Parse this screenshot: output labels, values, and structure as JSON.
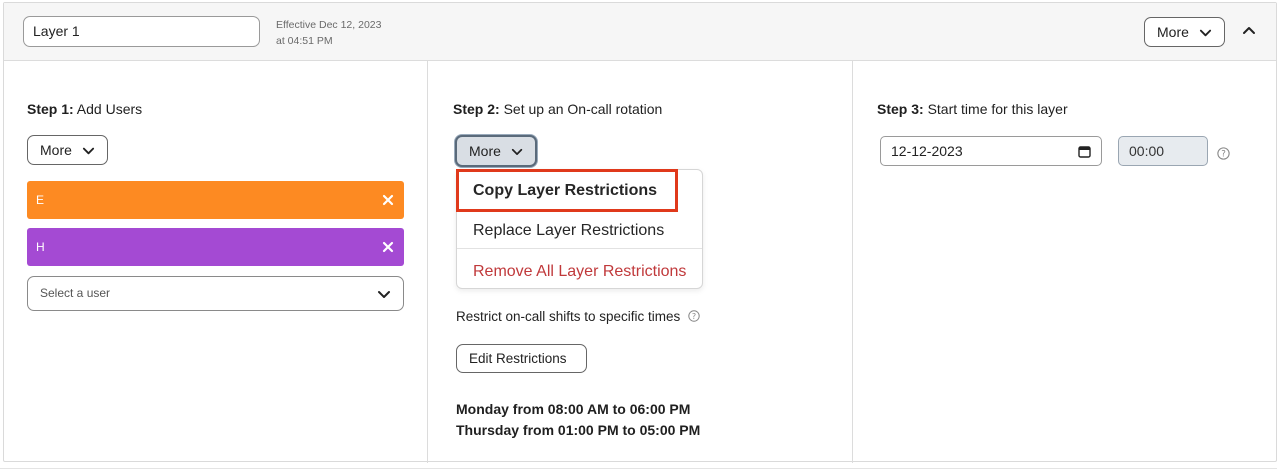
{
  "header": {
    "layer_name": "Layer 1",
    "effective": "Effective Dec 12, 2023 at 04:51 PM",
    "more_label": "More"
  },
  "step1": {
    "title_bold": "Step 1:",
    "title_text": " Add Users",
    "more_label": "More",
    "users": [
      {
        "initial": "E",
        "color": "#fd8a22"
      },
      {
        "initial": "H",
        "color": "#a44ad3"
      }
    ],
    "select_placeholder": "Select a user"
  },
  "step2": {
    "title_bold": "Step 2:",
    "title_text": " Set up an On-call rotation",
    "more_label": "More",
    "menu": {
      "copy": "Copy Layer Restrictions",
      "replace": "Replace Layer Restrictions",
      "remove": "Remove All Layer Restrictions",
      "remove_color": "#c0393b"
    },
    "highlight_color": "#e0391b",
    "restrict_label": "Restrict on-call shifts to specific times",
    "edit_label": "Edit Restrictions",
    "schedule": [
      "Monday from 08:00 AM to 06:00 PM",
      "Thursday from 01:00 PM to 05:00 PM"
    ]
  },
  "step3": {
    "title_bold": "Step 3:",
    "title_text": " Start time for this layer",
    "date_value": "12-12-2023",
    "time_value": "00:00"
  },
  "icons": {
    "chevron": "chevron-down-icon",
    "collapse": "chevron-up-icon",
    "remove": "close-icon",
    "help": "help-circle-icon",
    "calendar": "calendar-icon"
  }
}
